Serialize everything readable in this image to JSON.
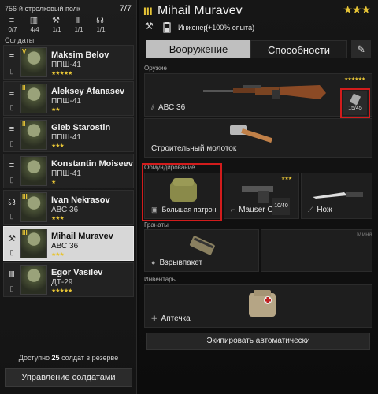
{
  "left_panel": {
    "regiment": "756-й стрелковый полк",
    "squad_count": "7/7",
    "class_counts": [
      {
        "icon": "assault-icon",
        "glyph": "≡",
        "count": "0/7"
      },
      {
        "icon": "squad-icon",
        "glyph": "▥",
        "count": "4/4"
      },
      {
        "icon": "engineer-icon",
        "glyph": "⚒",
        "count": "1/1"
      },
      {
        "icon": "gunner-icon",
        "glyph": "Ⅲ",
        "count": "1/1"
      },
      {
        "icon": "radio-icon",
        "glyph": "☊",
        "count": "1/1"
      }
    ],
    "soldiers_label": "Солдаты",
    "soldiers": [
      {
        "rank": "V",
        "name": "Maksim Belov",
        "weapon": "ППШ-41",
        "stars": "★★★★★",
        "kind": "≡",
        "kind2": "▯"
      },
      {
        "rank": "II",
        "name": "Aleksey Afanasev",
        "weapon": "ППШ-41",
        "stars": "★★",
        "kind": "≡",
        "kind2": "▯"
      },
      {
        "rank": "II",
        "name": "Gleb Starostin",
        "weapon": "ППШ-41",
        "stars": "★★★",
        "kind": "≡",
        "kind2": "▯"
      },
      {
        "rank": "",
        "name": "Konstantin Moiseev",
        "weapon": "ППШ-41",
        "stars": "★",
        "kind": "≡",
        "kind2": "▯"
      },
      {
        "rank": "III",
        "name": "Ivan Nekrasov",
        "weapon": "АВС 36",
        "stars": "★★★",
        "kind": "☊",
        "kind2": "▯"
      },
      {
        "rank": "III",
        "name": "Mihail Muravev",
        "weapon": "АВС 36",
        "stars": "★★★",
        "kind": "⚒",
        "kind2": "▯"
      },
      {
        "rank": "",
        "name": "Egor Vasilev",
        "weapon": "ДТ-29",
        "stars": "★★★★★",
        "kind": "Ⅲ",
        "kind2": "▯"
      }
    ],
    "reserve_prefix": "Доступно ",
    "reserve_count": "25",
    "reserve_suffix": " солдат в резерве",
    "manage_button": "Управление солдатами"
  },
  "hero": {
    "rank": "III",
    "name": "Mihail Muravev",
    "stars": "★★★",
    "class_name": "Инженер",
    "class_bonus": "(+100% опыта)"
  },
  "tabs": {
    "weapons": "Вооружение",
    "abilities": "Способности"
  },
  "sections": {
    "weapon": "Оружие",
    "equipment": "Обмундирование",
    "grenades": "Гранаты",
    "inventory": "Инвентарь"
  },
  "slots": {
    "primary": {
      "label": "АВС 36",
      "stars": "★★★★★★",
      "ammo": "15/45"
    },
    "tool": {
      "label": "Строительный молоток"
    },
    "pouch": {
      "label": "Большая патрон"
    },
    "pistol": {
      "label": "Mauser C96",
      "stars": "★★★",
      "ammo": "10/40"
    },
    "knife": {
      "label": "Нож"
    },
    "grenade": {
      "label": "Взрывпакет"
    },
    "mine_label": "Мина",
    "medkit": {
      "label": "Аптечка"
    }
  },
  "auto_equip_button": "Экипировать автоматически",
  "colors": {
    "accent_gold": "#e6c436",
    "highlight_red": "#d21c1c",
    "selected_row": "#d7d7d7"
  }
}
